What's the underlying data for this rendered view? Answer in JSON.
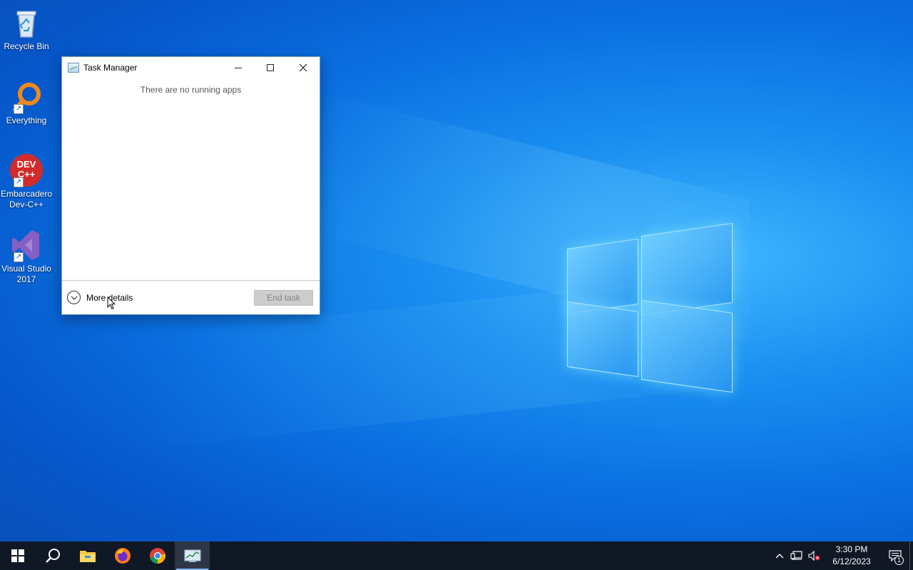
{
  "desktop": {
    "icons": [
      {
        "label": "Recycle Bin",
        "icon": "recycle-bin-icon"
      },
      {
        "label": "Everything",
        "icon": "everything-search-icon"
      },
      {
        "label": "Embarcadero Dev-C++",
        "icon": "dev-cpp-icon",
        "icon_text": "DEV C++"
      },
      {
        "label": "Visual Studio 2017",
        "icon": "visual-studio-icon"
      }
    ]
  },
  "task_manager": {
    "title": "Task Manager",
    "empty_message": "There are no running apps",
    "more_details_label": "More details",
    "end_task_label": "End task",
    "end_task_enabled": false
  },
  "taskbar": {
    "buttons": [
      {
        "name": "start",
        "icon": "windows-start-icon"
      },
      {
        "name": "search",
        "icon": "search-icon"
      },
      {
        "name": "file-explorer",
        "icon": "folder-icon"
      },
      {
        "name": "firefox",
        "icon": "firefox-icon"
      },
      {
        "name": "chrome",
        "icon": "chrome-icon"
      },
      {
        "name": "task-manager",
        "icon": "task-manager-icon",
        "active": true
      }
    ],
    "tray": {
      "time": "3:30 PM",
      "date": "6/12/2023",
      "notification_count": "1"
    }
  },
  "colors": {
    "taskbar_bg": "#101725",
    "active_indicator": "#76b9ed",
    "end_task_disabled_bg": "#cccccc"
  }
}
